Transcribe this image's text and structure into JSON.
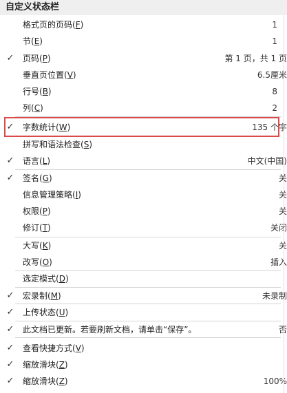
{
  "menu": {
    "title": "自定义状态栏",
    "check_glyph": "✓",
    "items": [
      {
        "label": "格式页的页码(",
        "key": "F",
        "close": ")",
        "value": "1",
        "checked": false
      },
      {
        "label": "节(",
        "key": "E",
        "close": ")",
        "value": "1",
        "checked": false
      },
      {
        "label": "页码(",
        "key": "P",
        "close": ")",
        "value": "第 1 页，共 1 页",
        "checked": true
      },
      {
        "label": "垂直页位置(",
        "key": "V",
        "close": ")",
        "value": "6.5厘米",
        "checked": false
      },
      {
        "label": "行号(",
        "key": "B",
        "close": ")",
        "value": "8",
        "checked": false
      },
      {
        "label": "列(",
        "key": "C",
        "close": ")",
        "value": "2",
        "checked": false
      },
      {
        "label": "字数统计(",
        "key": "W",
        "close": ")",
        "value": "135 个字",
        "checked": true
      },
      {
        "label": "拼写和语法检查(",
        "key": "S",
        "close": ")",
        "value": "",
        "checked": false
      },
      {
        "label": "语言(",
        "key": "L",
        "close": ")",
        "value": "中文(中国)",
        "checked": true
      },
      {
        "label": "签名(",
        "key": "G",
        "close": ")",
        "value": "关",
        "checked": true
      },
      {
        "label": "信息管理策略(",
        "key": "I",
        "close": ")",
        "value": "关",
        "checked": false
      },
      {
        "label": "权限(",
        "key": "P",
        "close": ")",
        "value": "关",
        "checked": false
      },
      {
        "label": "修订(",
        "key": "T",
        "close": ")",
        "value": "关闭",
        "checked": false
      },
      {
        "label": "大写(",
        "key": "K",
        "close": ")",
        "value": "关",
        "checked": false
      },
      {
        "label": "改写(",
        "key": "O",
        "close": ")",
        "value": "插入",
        "checked": false
      },
      {
        "label": "选定模式(",
        "key": "D",
        "close": ")",
        "value": "",
        "checked": false
      },
      {
        "label": "宏录制(",
        "key": "M",
        "close": ")",
        "value": "未录制",
        "checked": true
      },
      {
        "label": "上传状态(",
        "key": "U",
        "close": ")",
        "value": "",
        "checked": true
      },
      {
        "label": "此文档已更新。若要刷新文档，请单击“保存”。",
        "key": "",
        "close": "",
        "value": "否",
        "checked": true
      },
      {
        "label": "查看快捷方式(",
        "key": "V",
        "close": ")",
        "value": "",
        "checked": true
      },
      {
        "label": "缩放滑块(",
        "key": "Z",
        "close": ")",
        "value": "",
        "checked": true
      },
      {
        "label": "缩放滑块(",
        "key": "Z",
        "close": ")",
        "value": "100%",
        "checked": true
      }
    ]
  }
}
